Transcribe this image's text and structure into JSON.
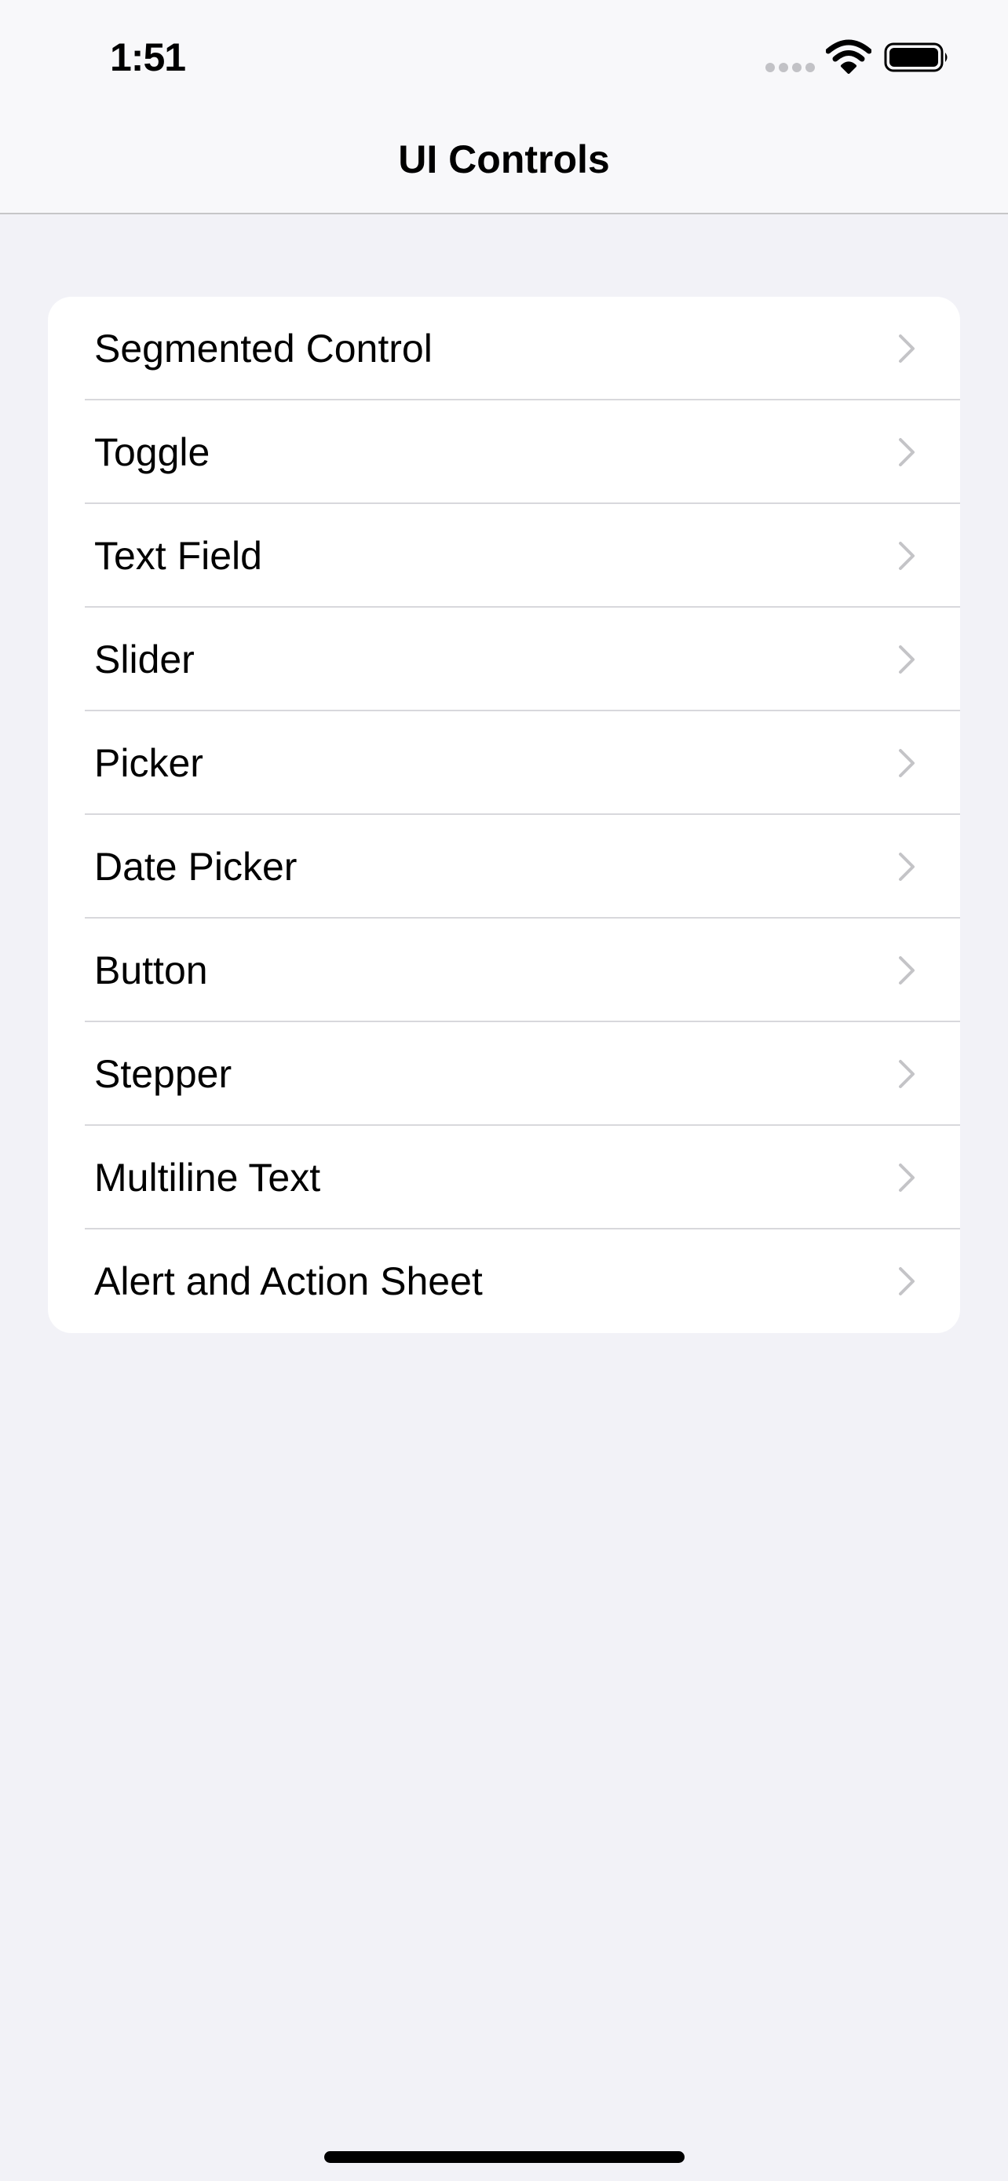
{
  "status_bar": {
    "time": "1:51",
    "icons": [
      "signal-dots-icon",
      "wifi-icon",
      "battery-icon"
    ]
  },
  "nav": {
    "title": "UI Controls"
  },
  "list": {
    "items": [
      {
        "label": "Segmented Control",
        "icon": "chevron-right-icon"
      },
      {
        "label": "Toggle",
        "icon": "chevron-right-icon"
      },
      {
        "label": "Text Field",
        "icon": "chevron-right-icon"
      },
      {
        "label": "Slider",
        "icon": "chevron-right-icon"
      },
      {
        "label": "Picker",
        "icon": "chevron-right-icon"
      },
      {
        "label": "Date Picker",
        "icon": "chevron-right-icon"
      },
      {
        "label": "Button",
        "icon": "chevron-right-icon"
      },
      {
        "label": "Stepper",
        "icon": "chevron-right-icon"
      },
      {
        "label": "Multiline Text",
        "icon": "chevron-right-icon"
      },
      {
        "label": "Alert and Action Sheet",
        "icon": "chevron-right-icon"
      }
    ]
  },
  "colors": {
    "background": "#f2f2f7",
    "bar_background": "#f8f8fa",
    "cell_background": "#ffffff",
    "separator": "#d8d8dc",
    "chevron": "#c4c4c7",
    "text": "#000000"
  }
}
